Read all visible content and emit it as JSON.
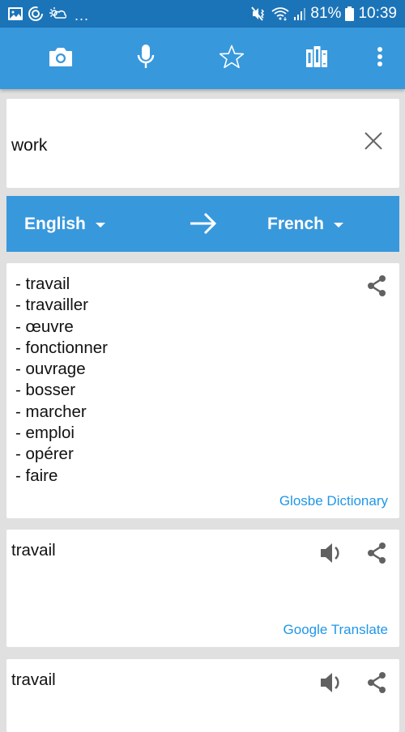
{
  "status_bar": {
    "left_icons": [
      "image-icon",
      "sync-icon",
      "weather-icon"
    ],
    "overflow": "...",
    "right_icons": [
      "vibrate-mute-icon",
      "wifi-icon",
      "signal-icon"
    ],
    "battery": "81%",
    "time": "10:39"
  },
  "toolbar": {
    "buttons": [
      {
        "name": "camera",
        "icon": "camera-icon"
      },
      {
        "name": "voice",
        "icon": "microphone-icon"
      },
      {
        "name": "favorites",
        "icon": "star-icon"
      },
      {
        "name": "library",
        "icon": "books-icon"
      },
      {
        "name": "more",
        "icon": "more-vert-icon"
      }
    ]
  },
  "input": {
    "value": "work",
    "clear_icon": "close-icon"
  },
  "languages": {
    "source": "English",
    "target": "French",
    "arrow_icon": "arrow-right-icon"
  },
  "results": [
    {
      "lines": [
        "- travail",
        "- travailler",
        "- œuvre",
        "- fonctionner",
        "- ouvrage",
        "- bosser",
        "- marcher",
        "- emploi",
        "- opérer",
        "- faire"
      ],
      "source": "Glosbe Dictionary",
      "actions": [
        "share-icon"
      ]
    },
    {
      "text": "travail",
      "source": "Google Translate",
      "actions": [
        "speaker-icon",
        "share-icon"
      ]
    },
    {
      "text": "travail",
      "actions": [
        "speaker-icon",
        "share-icon"
      ]
    }
  ],
  "colors": {
    "status_bar": "#1c74b8",
    "primary": "#3898dc",
    "link": "#2196e8",
    "background": "#e0e0e0",
    "icon_gray": "#616161"
  }
}
